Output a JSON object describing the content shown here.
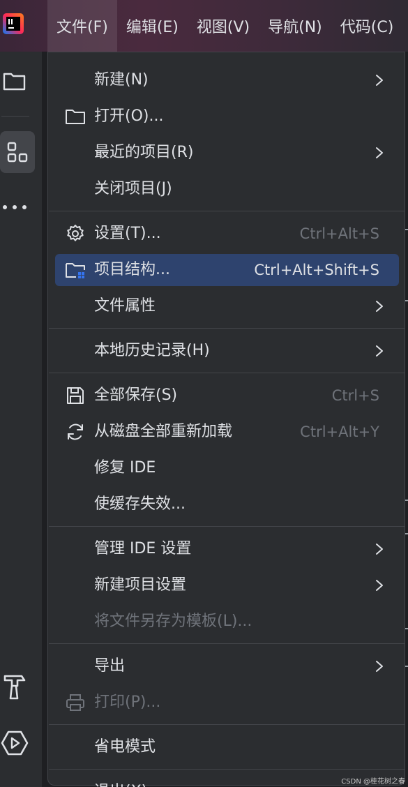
{
  "menubar": {
    "items": [
      {
        "label": "文件(F)"
      },
      {
        "label": "编辑(E)"
      },
      {
        "label": "视图(V)"
      },
      {
        "label": "导航(N)"
      },
      {
        "label": "代码(C)"
      }
    ],
    "active_index": 0
  },
  "file_menu": {
    "groups": [
      {
        "items": [
          {
            "label": "新建(N)",
            "icon": "",
            "shortcut": "",
            "submenu": true,
            "disabled": false
          },
          {
            "label": "打开(O)...",
            "icon": "folder-icon",
            "shortcut": "",
            "submenu": false,
            "disabled": false
          },
          {
            "label": "最近的项目(R)",
            "icon": "",
            "shortcut": "",
            "submenu": true,
            "disabled": false
          },
          {
            "label": "关闭项目(J)",
            "icon": "",
            "shortcut": "",
            "submenu": false,
            "disabled": false
          }
        ]
      },
      {
        "items": [
          {
            "label": "设置(T)...",
            "icon": "gear-icon",
            "shortcut": "Ctrl+Alt+S",
            "submenu": false,
            "disabled": false
          },
          {
            "label": "项目结构...",
            "icon": "project-structure-icon",
            "shortcut": "Ctrl+Alt+Shift+S",
            "submenu": false,
            "disabled": false,
            "highlighted": true
          },
          {
            "label": "文件属性",
            "icon": "",
            "shortcut": "",
            "submenu": true,
            "disabled": false
          }
        ]
      },
      {
        "items": [
          {
            "label": "本地历史记录(H)",
            "icon": "",
            "shortcut": "",
            "submenu": true,
            "disabled": false
          }
        ]
      },
      {
        "items": [
          {
            "label": "全部保存(S)",
            "icon": "save-icon",
            "shortcut": "Ctrl+S",
            "submenu": false,
            "disabled": false
          },
          {
            "label": "从磁盘全部重新加载",
            "icon": "reload-icon",
            "shortcut": "Ctrl+Alt+Y",
            "submenu": false,
            "disabled": false
          },
          {
            "label": "修复 IDE",
            "icon": "",
            "shortcut": "",
            "submenu": false,
            "disabled": false
          },
          {
            "label": "使缓存失效...",
            "icon": "",
            "shortcut": "",
            "submenu": false,
            "disabled": false
          }
        ]
      },
      {
        "items": [
          {
            "label": "管理 IDE 设置",
            "icon": "",
            "shortcut": "",
            "submenu": true,
            "disabled": false
          },
          {
            "label": "新建项目设置",
            "icon": "",
            "shortcut": "",
            "submenu": true,
            "disabled": false
          },
          {
            "label": "将文件另存为模板(L)...",
            "icon": "",
            "shortcut": "",
            "submenu": false,
            "disabled": true
          }
        ]
      },
      {
        "items": [
          {
            "label": "导出",
            "icon": "",
            "shortcut": "",
            "submenu": true,
            "disabled": false
          },
          {
            "label": "打印(P)...",
            "icon": "print-icon",
            "shortcut": "",
            "submenu": false,
            "disabled": true
          }
        ]
      },
      {
        "items": [
          {
            "label": "省电模式",
            "icon": "",
            "shortcut": "",
            "submenu": false,
            "disabled": false
          }
        ]
      },
      {
        "items": [
          {
            "label": "退出(X)",
            "icon": "",
            "shortcut": "",
            "submenu": false,
            "disabled": false
          }
        ]
      }
    ]
  },
  "toolstrip": {
    "icons": [
      "project-folder-icon",
      "structure-icon",
      "more-icon",
      "build-hammer-icon",
      "run-icon"
    ]
  },
  "watermark": "CSDN @桂花树之春",
  "colors": {
    "menu_bg": "#2b2d30",
    "highlight": "#2e436e",
    "text": "#dfe1e5",
    "muted": "#6f737a",
    "accent_blue": "#3574f0"
  }
}
